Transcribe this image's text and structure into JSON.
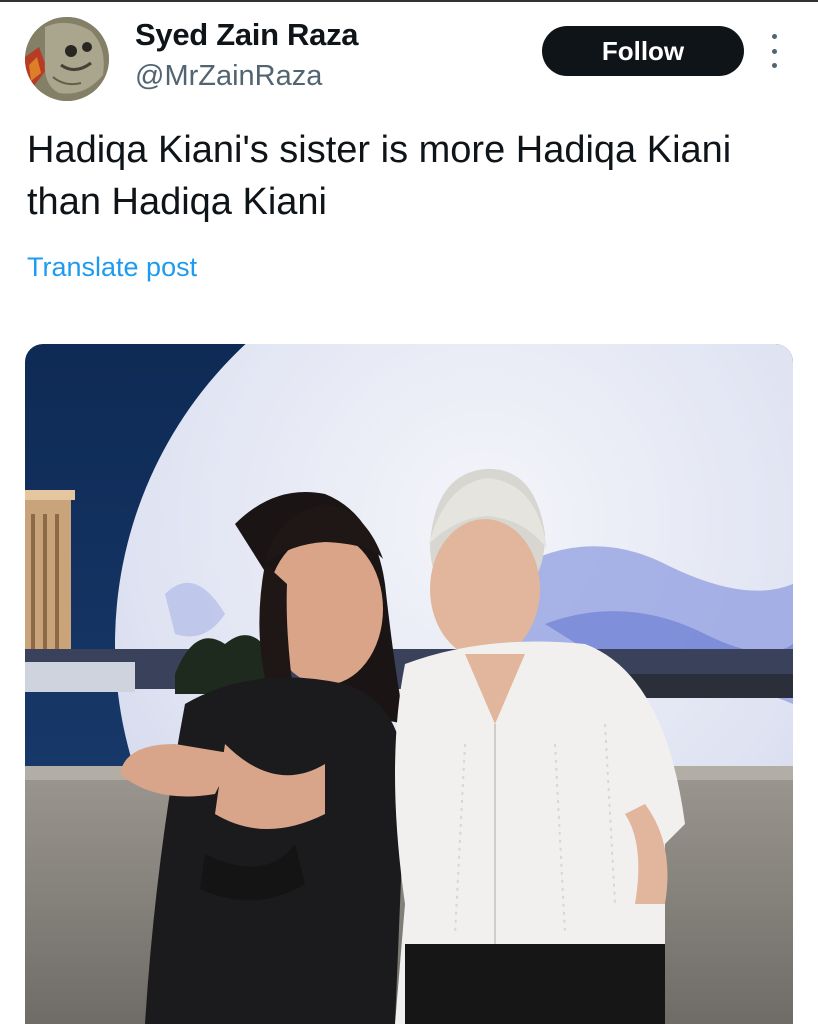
{
  "author": {
    "name": "Syed Zain Raza",
    "handle": "@MrZainRaza"
  },
  "actions": {
    "follow_label": "Follow",
    "more_icon": "more-options-icon"
  },
  "post": {
    "text": "Hadiqa Kiani's sister is more Hadiqa Kiani than Hadiqa Kiani",
    "translate_label": "Translate post"
  },
  "colors": {
    "text_primary": "#0f1419",
    "text_secondary": "#536471",
    "link": "#1d9bf0",
    "follow_bg": "#0f1419"
  }
}
